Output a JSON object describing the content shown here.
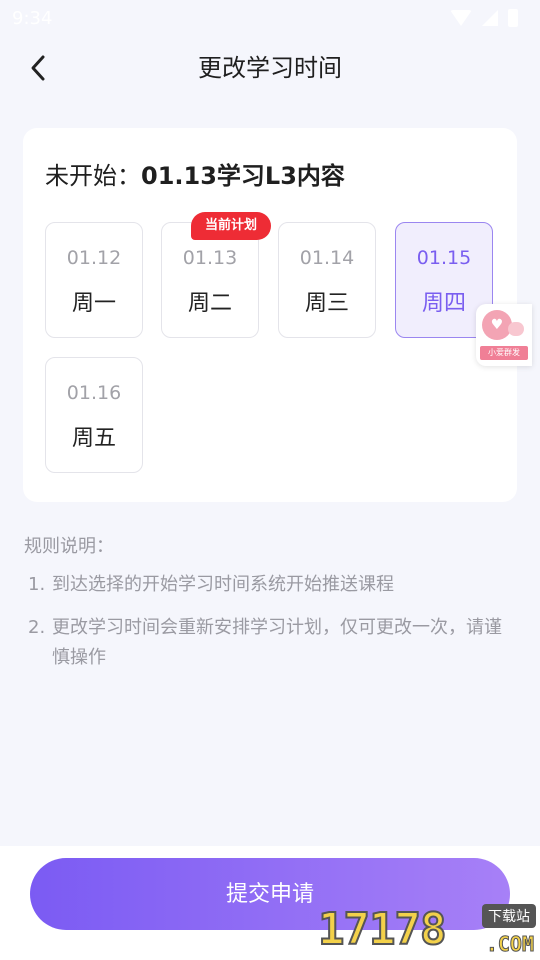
{
  "status_bar": {
    "time": "9:34"
  },
  "nav": {
    "title": "更改学习时间"
  },
  "card": {
    "title_prefix": "未开始：",
    "title_main": "01.13学习L3内容",
    "current_badge": "当前计划",
    "days": [
      {
        "date": "01.12",
        "weekday": "周一"
      },
      {
        "date": "01.13",
        "weekday": "周二"
      },
      {
        "date": "01.14",
        "weekday": "周三"
      },
      {
        "date": "01.15",
        "weekday": "周四"
      },
      {
        "date": "01.16",
        "weekday": "周五"
      }
    ],
    "selected_index": 3,
    "current_index": 1
  },
  "rules": {
    "title": "规则说明：",
    "items": [
      {
        "num": "1.",
        "text": "到达选择的开始学习时间系统开始推送课程"
      },
      {
        "num": "2.",
        "text": "更改学习时间会重新安排学习计划，仅可更改一次，请谨慎操作"
      }
    ]
  },
  "submit": {
    "label": "提交申请"
  },
  "float_widget": {
    "label": "小爱群发"
  },
  "watermark": {
    "digits": "17178",
    "tag": "下载站",
    "suffix": ".COM"
  },
  "colors": {
    "accent": "#7b5bf3",
    "badge": "#ee2c35",
    "background": "#f5f6fc"
  }
}
